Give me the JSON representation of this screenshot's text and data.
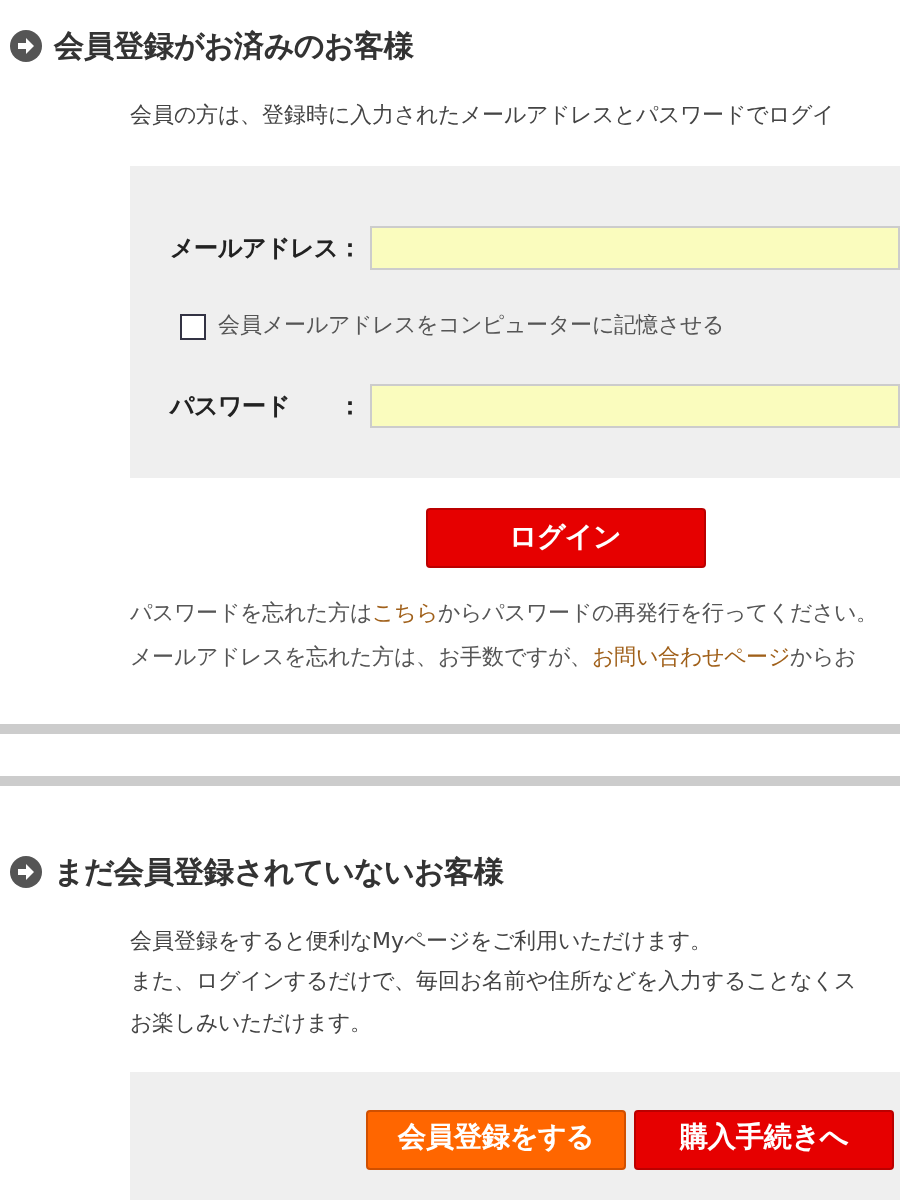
{
  "member_section": {
    "heading": "会員登録がお済みのお客様",
    "intro": "会員の方は、登録時に入力されたメールアドレスとパスワードでログイ",
    "email_label": "メールアドレス：",
    "remember": {
      "label": "会員メールアドレスをコンピューターに記憶させる",
      "checked": false
    },
    "password_label": "パスワード　　：",
    "login_button": "ログイン",
    "help_lines": [
      {
        "before": "パスワードを忘れた方は",
        "link": "こちら",
        "after": "からパスワードの再発行を行ってください。"
      },
      {
        "before": "メールアドレスを忘れた方は、お手数ですが、",
        "link": "お問い合わせページ",
        "after": "からお"
      }
    ]
  },
  "guest_section": {
    "heading": "まだ会員登録されていないお客様",
    "lines": [
      "会員登録をすると便利なMyページをご利用いただけます。",
      "また、ログインするだけで、毎回お名前や住所などを入力することなくス",
      "お楽しみいただけます。"
    ],
    "buttons": [
      {
        "label": "会員登録をする",
        "kind": "register"
      },
      {
        "label": "購入手続きへ",
        "kind": "checkout"
      }
    ]
  }
}
